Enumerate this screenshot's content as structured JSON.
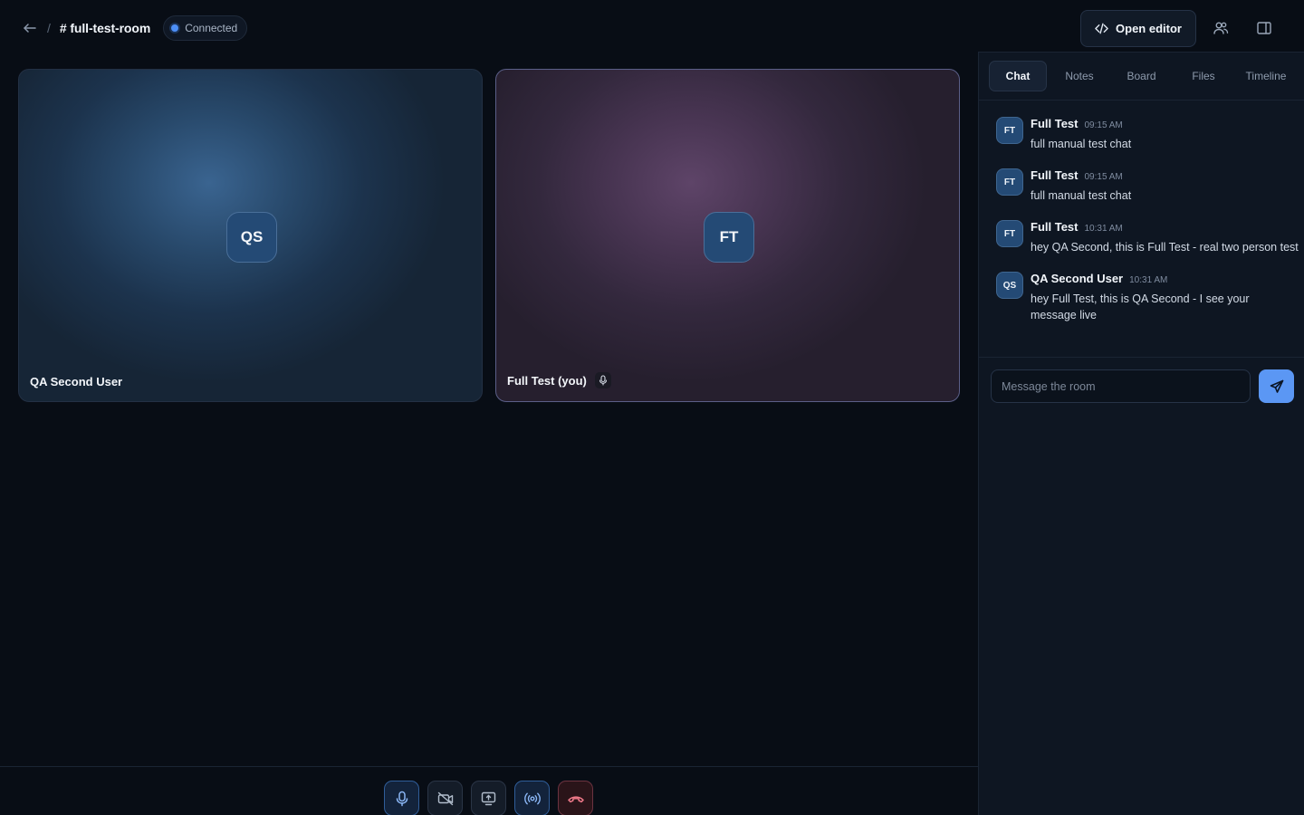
{
  "header": {
    "separator": "/",
    "room_name": "# full-test-room",
    "status": "Connected",
    "open_editor_label": "Open editor"
  },
  "tiles": [
    {
      "initials": "QS",
      "label": "QA Second User"
    },
    {
      "initials": "FT",
      "label": "Full Test (you)"
    }
  ],
  "panel": {
    "tabs": [
      "Chat",
      "Notes",
      "Board",
      "Files",
      "Timeline"
    ],
    "active_tab": "Chat",
    "messages": [
      {
        "initials": "FT",
        "author": "Full Test",
        "time": "09:15 AM",
        "text": "full manual test chat"
      },
      {
        "initials": "FT",
        "author": "Full Test",
        "time": "09:15 AM",
        "text": "full manual test chat"
      },
      {
        "initials": "FT",
        "author": "Full Test",
        "time": "10:31 AM",
        "text": "hey QA Second, this is Full Test - real two person test"
      },
      {
        "initials": "QS",
        "author": "QA Second User",
        "time": "10:31 AM",
        "text": "hey Full Test, this is QA Second - I see your message live"
      }
    ],
    "input_placeholder": "Message the room"
  },
  "controls": {
    "icons": [
      "mic-icon",
      "camera-off-icon",
      "screen-share-icon",
      "broadcast-icon",
      "hang-up-icon"
    ]
  },
  "colors": {
    "accent": "#5b97f4",
    "status_dot": "#4d8ff7",
    "leave": "#f07a8a"
  }
}
